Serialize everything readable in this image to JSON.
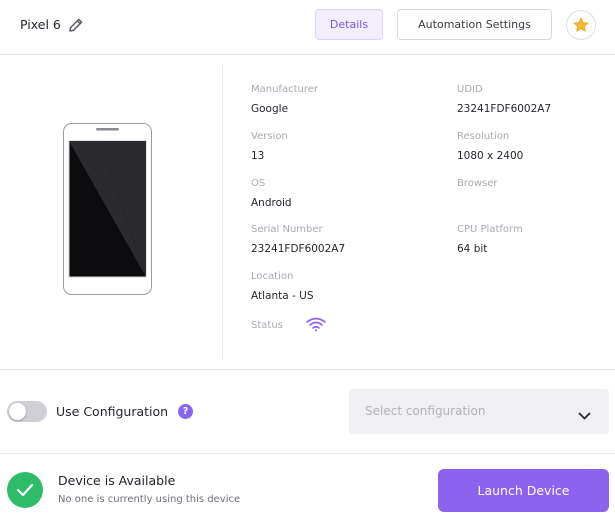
{
  "header": {
    "device_name": "Pixel 6",
    "tabs": {
      "details": "Details",
      "automation": "Automation Settings"
    }
  },
  "details": {
    "manufacturer": {
      "label": "Manufacturer",
      "value": "Google"
    },
    "udid": {
      "label": "UDID",
      "value": "23241FDF6002A7"
    },
    "version": {
      "label": "Version",
      "value": "13"
    },
    "resolution": {
      "label": "Resolution",
      "value": "1080 x 2400"
    },
    "os": {
      "label": "OS",
      "value": "Android"
    },
    "browser": {
      "label": "Browser",
      "value": ""
    },
    "serial": {
      "label": "Serial Number",
      "value": "23241FDF6002A7"
    },
    "cpu": {
      "label": "CPU Platform",
      "value": "64 bit"
    },
    "location": {
      "label": "Location",
      "value": "Atlanta - US"
    },
    "status": {
      "label": "Status",
      "icon": "wifi-icon"
    }
  },
  "configuration": {
    "label": "Use Configuration",
    "help": "?",
    "select_placeholder": "Select configuration",
    "enabled": false
  },
  "footer": {
    "status_title": "Device is Available",
    "status_subtitle": "No one is currently using this device",
    "launch_label": "Launch Device"
  },
  "colors": {
    "accent": "#8d62ef",
    "available": "#2fbc6a",
    "star": "#f6b82c"
  }
}
